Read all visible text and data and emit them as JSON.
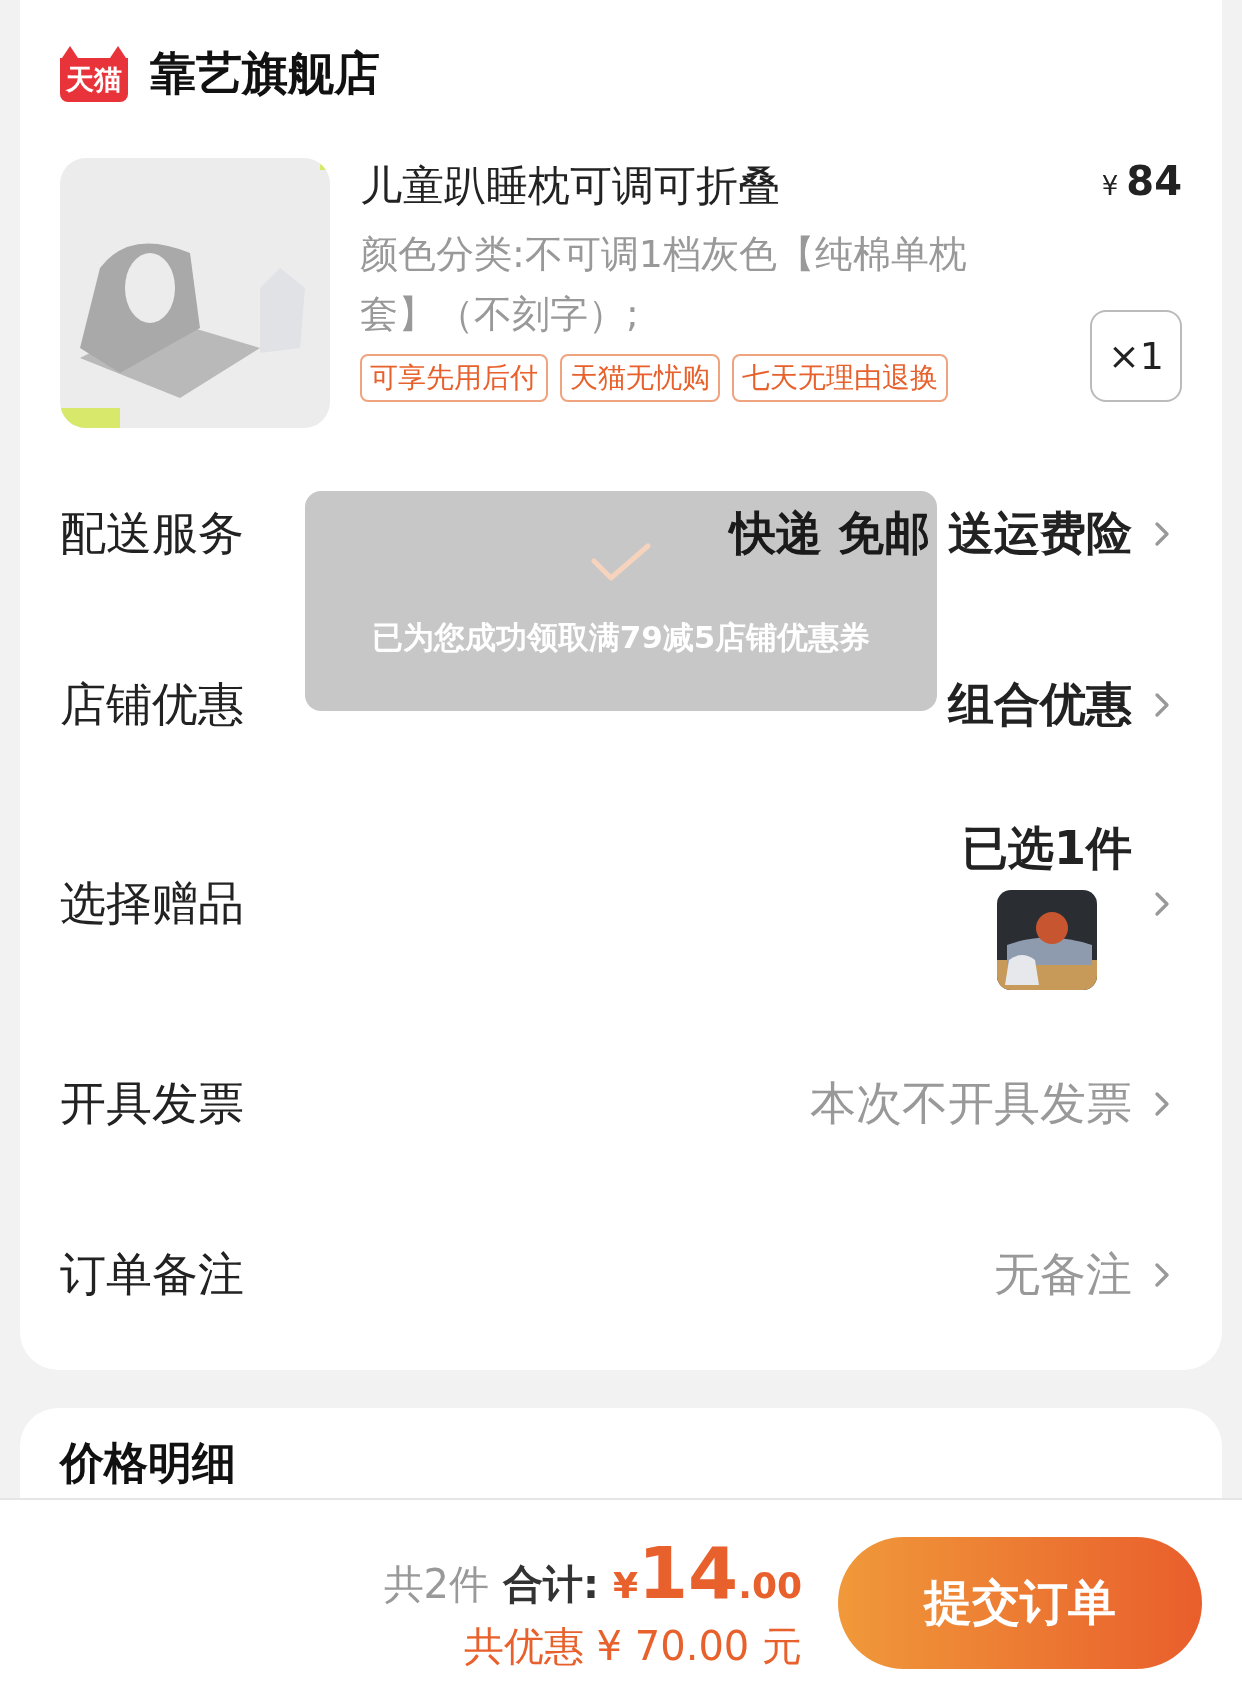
{
  "store": {
    "badge": "天猫",
    "name": "靠艺旗舰店"
  },
  "product": {
    "image": {
      "kind": "picture"
    },
    "title": "儿童趴睡枕可调可折叠",
    "currency": "¥",
    "price": "84",
    "spec": "颜色分类:不可调1档灰色【纯棉单枕套】（不刻字）;",
    "tags": [
      "可享先用后付",
      "天猫无忧购",
      "七天无理由退换"
    ],
    "quantity": "×1"
  },
  "rows": [
    {
      "label": "配送服务",
      "values": [
        "快递 免邮",
        "送运费险"
      ],
      "muted": false
    },
    {
      "label": "店铺优惠",
      "values": [
        "组合优惠"
      ],
      "muted": false
    },
    {
      "label": "选择赠品",
      "values": [
        "已选1件"
      ],
      "muted": false,
      "thumbnail": {
        "kind": "picture"
      }
    },
    {
      "label": "开具发票",
      "values": [
        "本次不开具发票"
      ],
      "muted": true
    },
    {
      "label": "订单备注",
      "values": [
        "无备注"
      ],
      "muted": true
    }
  ],
  "toast": {
    "message": "已为您成功领取满79减5店铺优惠券"
  },
  "price_details": {
    "title": "价格明细"
  },
  "footer": {
    "count": "共2件",
    "total_label": "合计:",
    "currency": "¥",
    "total_integer": "14",
    "total_decimal": ".00",
    "discount": "共优惠 ¥ 70.00 元",
    "submit": "提交订单"
  }
}
